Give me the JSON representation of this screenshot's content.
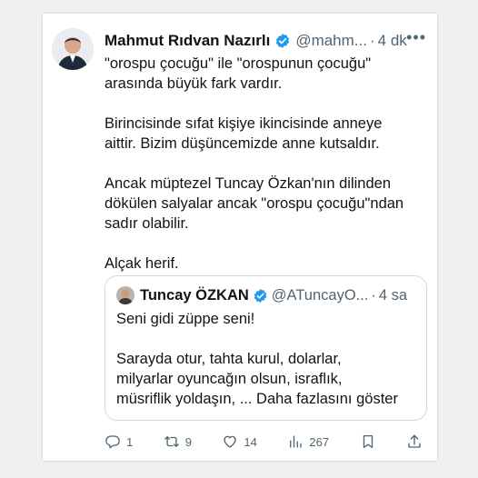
{
  "tweet": {
    "author_name": "Mahmut Rıdvan Nazırlı",
    "handle": "@mahm...",
    "separator": "·",
    "time": "4 dk",
    "more_icon": "more-horizontal-icon",
    "verified_icon": "verified-badge-icon",
    "paragraphs": [
      [
        "\"orospu çocuğu\" ile \"orospunun çocuğu\"",
        "arasında büyük fark vardır."
      ],
      [
        "Birincisinde sıfat kişiye ikincisinde anneye",
        "aittir. Bizim düşüncemizde anne kutsaldır."
      ],
      [
        "Ancak müptezel Tuncay Özkan'nın dilinden",
        "dökülen salyalar ancak \"orospu çocuğu\"ndan",
        "sadır olabilir."
      ],
      [
        "Alçak herif."
      ]
    ]
  },
  "quoted": {
    "author_name": "Tuncay ÖZKAN",
    "handle": "@ATuncayO...",
    "separator": "·",
    "time": "4 sa",
    "lines": [
      "Seni gidi züppe seni!",
      "",
      "Sarayda otur, tahta kurul, dolarlar,",
      "milyarlar oyuncağın olsun, israflık,",
      "müsriflik yoldaşın, ... Daha fazlasını göster"
    ]
  },
  "actions": {
    "reply_count": "1",
    "retweet_count": "9",
    "like_count": "14",
    "views_count": "267"
  },
  "colors": {
    "verified": "#1d9bf0",
    "text": "#0f1419",
    "muted": "#536471",
    "border": "#cfd9de"
  }
}
